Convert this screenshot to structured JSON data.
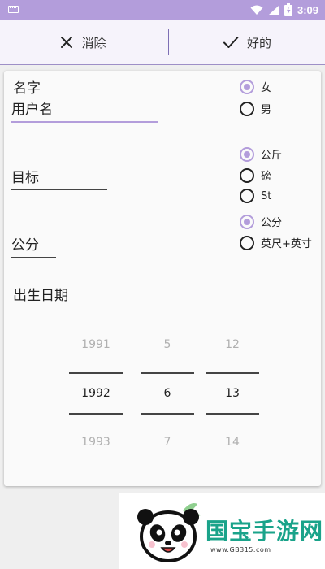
{
  "status_bar": {
    "time": "3:09",
    "icons": [
      "keyboard-icon",
      "wifi-icon",
      "battery-charging-icon"
    ]
  },
  "action_bar": {
    "cancel_label": "消除",
    "ok_label": "好的"
  },
  "form": {
    "name": {
      "label": "名字",
      "value": "用户名"
    },
    "gender": {
      "options": [
        "女",
        "男"
      ],
      "selected": "女"
    },
    "goal": {
      "value": "目标"
    },
    "weight_unit": {
      "options": [
        "公斤",
        "磅",
        "St"
      ],
      "selected": "公斤"
    },
    "height": {
      "value": "公分"
    },
    "height_unit": {
      "options": [
        "公分",
        "英尺+英寸"
      ],
      "selected": "公分"
    },
    "dob": {
      "label": "出生日期",
      "year": {
        "prev": "1991",
        "value": "1992",
        "next": "1993"
      },
      "month": {
        "prev": "5",
        "value": "6",
        "next": "7"
      },
      "day": {
        "prev": "12",
        "value": "13",
        "next": "14"
      }
    }
  },
  "watermark": {
    "brand": "国宝手游网",
    "url": "www.GB315.com"
  },
  "colors": {
    "accent": "#b39ddb",
    "status_bar": "#b39ddb",
    "watermark": "#1aa38a"
  }
}
